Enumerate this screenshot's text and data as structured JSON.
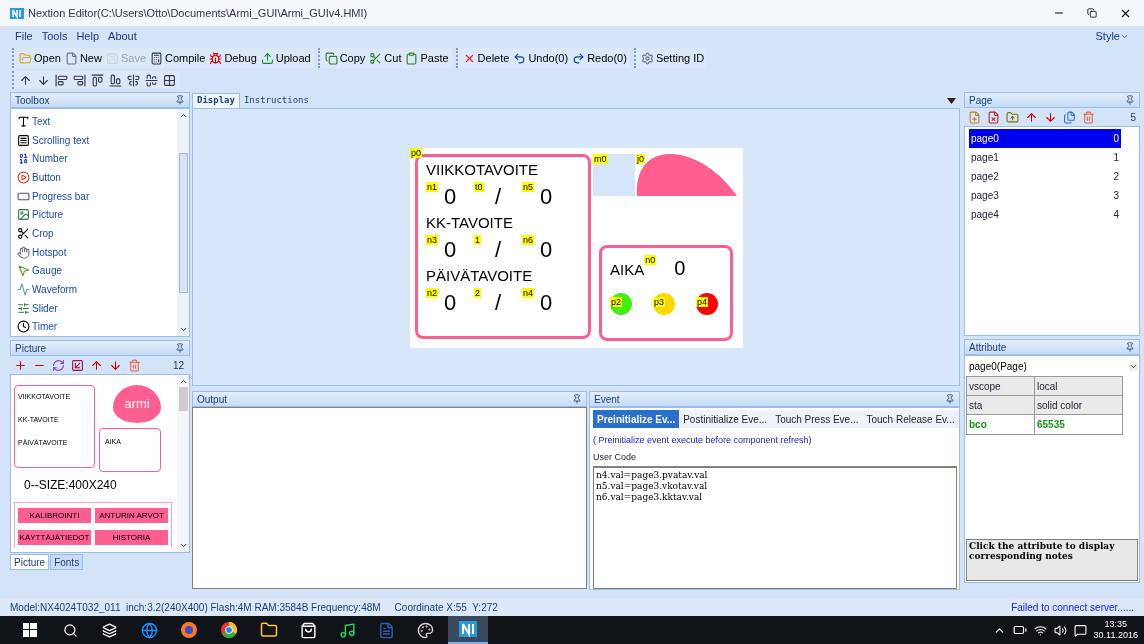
{
  "window": {
    "title": "Nextion Editor(C:\\Users\\Otto\\Documents\\Armi_GUI\\Armi_GUIv4.HMI)"
  },
  "menu": [
    "File",
    "Tools",
    "Help",
    "About"
  ],
  "style_menu": "Style",
  "toolbar_groups": [
    [
      {
        "label": "Open",
        "disabled": false
      },
      {
        "label": "New",
        "disabled": false
      },
      {
        "label": "Save",
        "disabled": true
      },
      {
        "label": "Compile",
        "disabled": false
      },
      {
        "label": "Debug",
        "disabled": false
      },
      {
        "label": "Upload",
        "disabled": false
      }
    ],
    [
      {
        "label": "Copy",
        "disabled": false
      },
      {
        "label": "Cut",
        "disabled": false
      },
      {
        "label": "Paste",
        "disabled": false
      }
    ],
    [
      {
        "label": "Delete",
        "disabled": false
      },
      {
        "label": "Undo(0)",
        "disabled": false
      },
      {
        "label": "Redo(0)",
        "disabled": false
      }
    ],
    [
      {
        "label": "Setting ID",
        "disabled": false
      }
    ]
  ],
  "toolbox": {
    "title": "Toolbox",
    "items": [
      "Text",
      "Scrolling text",
      "Number",
      "Button",
      "Progress bar",
      "Picture",
      "Crop",
      "Hotspot",
      "Gauge",
      "Waveform",
      "Slider",
      "Timer"
    ]
  },
  "picture_panel": {
    "title": "Picture",
    "count": "12",
    "preview": {
      "left_labels": [
        "VIIKKOTAVOITE",
        "KK-TAVOITE",
        "PÄIVÄTAVOITE"
      ],
      "right_label": "AIKA",
      "logo": "armi",
      "caption": "0--SIZE:400X240",
      "buttons": [
        "KALIBROINTI",
        "ANTURIN ARVOT",
        "KÄYTTÄJÄTIEDOT",
        "HISTORIA"
      ]
    }
  },
  "left_tabs": [
    {
      "label": "Picture",
      "selected": true
    },
    {
      "label": "Fonts",
      "selected": false
    }
  ],
  "center_tabs": [
    {
      "label": "Display",
      "selected": true
    },
    {
      "label": "Instructions",
      "selected": false
    }
  ],
  "canvas": {
    "frame_tag": "p0",
    "groups": [
      {
        "title": "VIIKKOTAVOITE",
        "cells": [
          {
            "tag": "n1",
            "value": "0"
          },
          {
            "tag": "t0",
            "value": "/"
          },
          {
            "tag": "n5",
            "value": "0"
          }
        ]
      },
      {
        "title": "KK-TAVOITE",
        "cells": [
          {
            "tag": "n3",
            "value": "0"
          },
          {
            "tag": "1",
            "value": "/"
          },
          {
            "tag": "n6",
            "value": "0"
          }
        ]
      },
      {
        "title": "PÄIVÄTAVOITE",
        "cells": [
          {
            "tag": "n2",
            "value": "0"
          },
          {
            "tag": "2",
            "value": "/"
          },
          {
            "tag": "n4",
            "value": "0"
          }
        ]
      }
    ],
    "box_tag": "m0",
    "logo_tag": "j0",
    "time": {
      "title": "AIKA",
      "tag": "n0",
      "value": "0"
    },
    "lamps": [
      {
        "tag": "p2",
        "color": "#44ee11"
      },
      {
        "tag": "p3",
        "color": "#ffd700"
      },
      {
        "tag": "p4",
        "color": "#ff0000"
      }
    ]
  },
  "output": {
    "title": "Output"
  },
  "event": {
    "title": "Event",
    "tabs": [
      {
        "label": "Preinitialize Ev...",
        "selected": true
      },
      {
        "label": "Postinitialize Eve...",
        "selected": false
      },
      {
        "label": "Touch Press Eve...",
        "selected": false
      },
      {
        "label": "Touch Release Ev...",
        "selected": false
      }
    ],
    "description": "( Preinitialize event execute before component refresh)",
    "code_label": "User Code",
    "code": [
      "n4.val=page3.pvatav.val",
      "n5.val=page3.vkotav.val",
      "n6.val=page3.kktav.val"
    ]
  },
  "pages": {
    "title": "Page",
    "count": "5",
    "items": [
      {
        "name": "page0",
        "index": "0",
        "selected": true
      },
      {
        "name": "page1",
        "index": "1",
        "selected": false
      },
      {
        "name": "page2",
        "index": "2",
        "selected": false
      },
      {
        "name": "page3",
        "index": "3",
        "selected": false
      },
      {
        "name": "page4",
        "index": "4",
        "selected": false
      }
    ]
  },
  "attribute": {
    "title": "Attribute",
    "selector": "page0(Page)",
    "rows": [
      {
        "name": "vscope",
        "value": "local",
        "modified": false
      },
      {
        "name": "sta",
        "value": "solid color",
        "modified": false
      },
      {
        "name": "bco",
        "value": "65535",
        "modified": true
      }
    ],
    "notes": "Click the attribute to display corresponding notes"
  },
  "status": {
    "model": "Model:NX4024T032_011  inch:3.2(240X400) Flash:4M RAM:3584B Frequency:48M",
    "coordinate": "Coordinate X:55  Y:272",
    "connection": "Failed to connect server......"
  },
  "taskbar": {
    "time": "13:35",
    "date": "30.11.2016"
  }
}
